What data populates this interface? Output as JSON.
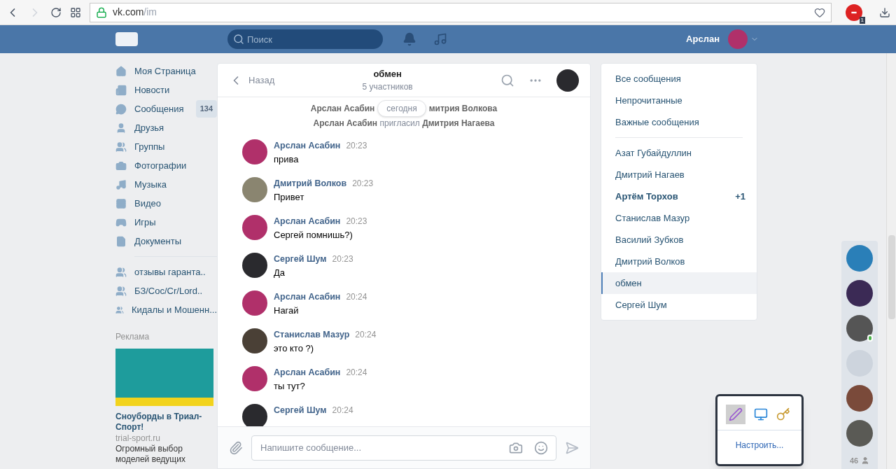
{
  "browser": {
    "url_host": "vk.com",
    "url_path": "/im",
    "adblock_count": "1"
  },
  "header": {
    "search_placeholder": "Поиск",
    "user_name": "Арслан"
  },
  "nav": [
    {
      "label": "Моя Страница"
    },
    {
      "label": "Новости"
    },
    {
      "label": "Сообщения",
      "badge": "134"
    },
    {
      "label": "Друзья"
    },
    {
      "label": "Группы"
    },
    {
      "label": "Фотографии"
    },
    {
      "label": "Музыка"
    },
    {
      "label": "Видео"
    },
    {
      "label": "Игры"
    },
    {
      "label": "Документы"
    }
  ],
  "groups": [
    {
      "label": "отзывы гаранта.."
    },
    {
      "label": "БЗ/Coc/Cr/Lord.."
    },
    {
      "label": "Кидалы и Мошенн..."
    }
  ],
  "ad": {
    "heading": "Реклама",
    "title": "Сноуборды в Триал-Спорт!",
    "domain": "trial-sport.ru",
    "text": "Огромный выбор моделей ведущих"
  },
  "chat": {
    "back_label": "Назад",
    "title": "обмен",
    "subtitle": "5 участников",
    "date_badge": "сегодня",
    "events": [
      {
        "kind": "covered",
        "left": "Арслан Асабин",
        "right": "митрия Волкова"
      },
      {
        "kind": "invite",
        "actor": "Арслан Асабин",
        "verb": "пригласил",
        "target": "Дмитрия Нагаева"
      }
    ],
    "messages": [
      {
        "author": "Арслан Асабин",
        "time": "20:23",
        "text": "прива",
        "color": "#b0306a"
      },
      {
        "author": "Дмитрий Волков",
        "time": "20:23",
        "text": "Привет",
        "color": "#8a8570"
      },
      {
        "author": "Арслан Асабин",
        "time": "20:23",
        "text": "Сергей помнишь?)",
        "color": "#b0306a"
      },
      {
        "author": "Сергей Шум",
        "time": "20:23",
        "text": "Да",
        "color": "#2a2a2e"
      },
      {
        "author": "Арслан Асабин",
        "time": "20:24",
        "text": "Нагай",
        "color": "#b0306a"
      },
      {
        "author": "Станислав Мазур",
        "time": "20:24",
        "text": "это кто ?)",
        "color": "#4a4036"
      },
      {
        "author": "Арслан Асабин",
        "time": "20:24",
        "text": "ты тут?",
        "color": "#b0306a"
      },
      {
        "author": "Сергей Шум",
        "time": "20:24",
        "color": "#2a2a2e"
      }
    ],
    "input_placeholder": "Напишите сообщение..."
  },
  "folders": [
    {
      "label": "Все сообщения",
      "selected": false
    },
    {
      "label": "Непрочитанные",
      "selected": false
    },
    {
      "label": "Важные сообщения",
      "selected": false
    }
  ],
  "conversations": [
    {
      "name": "Азат Губайдуллин",
      "unread": false,
      "selected": false
    },
    {
      "name": "Дмитрий Нагаев",
      "unread": false,
      "selected": false
    },
    {
      "name": "Артём Торхов",
      "unread": true,
      "count": "+1",
      "selected": false
    },
    {
      "name": "Станислав Мазур",
      "unread": false,
      "selected": false
    },
    {
      "name": "Василий Зубков",
      "unread": false,
      "selected": false
    },
    {
      "name": "Дмитрий Волков",
      "unread": false,
      "selected": false
    },
    {
      "name": "обмен",
      "unread": false,
      "selected": true
    },
    {
      "name": "Сергей Шум",
      "unread": false,
      "selected": false
    }
  ],
  "friends": {
    "items": [
      {
        "color": "#2a7fb8",
        "online": false
      },
      {
        "color": "#3b2a55",
        "online": false
      },
      {
        "color": "#555555",
        "online": true
      },
      {
        "color": "#cdd4dd",
        "online": false
      },
      {
        "color": "#7a4a3a",
        "online": false
      },
      {
        "color": "#5a5a55",
        "online": false
      }
    ],
    "count": "46"
  },
  "tray": {
    "action": "Настроить..."
  }
}
